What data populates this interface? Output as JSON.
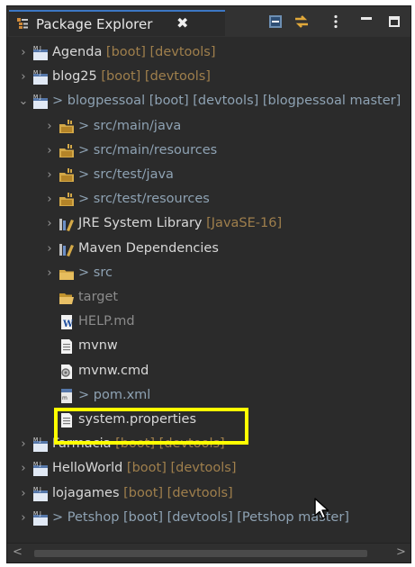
{
  "view": {
    "title": "Package Explorer",
    "close_glyph": "✖",
    "toolbar": [
      {
        "name": "collapse-all-icon"
      },
      {
        "name": "link-with-editor-icon"
      },
      {
        "name": "view-menu-icon"
      },
      {
        "name": "minimize-icon"
      },
      {
        "name": "maximize-icon"
      }
    ]
  },
  "tree": [
    {
      "text": "Agenda",
      "decoration": " [boot] [devtools]",
      "prefix": "",
      "suffix": "",
      "icon": "maven-project",
      "chevron": "collapsed",
      "level": 0,
      "git": false,
      "dim": false
    },
    {
      "text": "blog25",
      "decoration": " [boot] [devtools]",
      "prefix": "",
      "suffix": "",
      "icon": "maven-project",
      "chevron": "collapsed",
      "level": 0,
      "git": false,
      "dim": false
    },
    {
      "text": "blogpessoal [boot] [devtools] [blogpessoal master]",
      "decoration": "",
      "prefix": "> ",
      "suffix": "",
      "icon": "maven-project",
      "chevron": "expanded",
      "level": 0,
      "git": true,
      "dim": false
    },
    {
      "text": "src/main/java",
      "decoration": "",
      "prefix": "> ",
      "suffix": "",
      "icon": "source-folder",
      "chevron": "collapsed",
      "level": 1,
      "git": true,
      "dim": false
    },
    {
      "text": "src/main/resources",
      "decoration": "",
      "prefix": "> ",
      "suffix": "",
      "icon": "source-folder",
      "chevron": "collapsed",
      "level": 1,
      "git": true,
      "dim": false
    },
    {
      "text": "src/test/java",
      "decoration": "",
      "prefix": "> ",
      "suffix": "",
      "icon": "source-folder",
      "chevron": "collapsed",
      "level": 1,
      "git": true,
      "dim": false
    },
    {
      "text": "src/test/resources",
      "decoration": "",
      "prefix": "> ",
      "suffix": "",
      "icon": "source-folder",
      "chevron": "collapsed",
      "level": 1,
      "git": true,
      "dim": false
    },
    {
      "text": "JRE System Library",
      "decoration": " [JavaSE-16]",
      "prefix": "",
      "suffix": "",
      "icon": "library",
      "chevron": "collapsed",
      "level": 1,
      "git": false,
      "dim": false
    },
    {
      "text": "Maven Dependencies",
      "decoration": "",
      "prefix": "",
      "suffix": "",
      "icon": "library",
      "chevron": "collapsed",
      "level": 1,
      "git": false,
      "dim": false
    },
    {
      "text": "src",
      "decoration": "",
      "prefix": "> ",
      "suffix": "",
      "icon": "folder",
      "chevron": "collapsed",
      "level": 1,
      "git": true,
      "dim": false
    },
    {
      "text": "target",
      "decoration": "",
      "prefix": "",
      "suffix": "",
      "icon": "folder-open",
      "chevron": "none",
      "level": 1,
      "git": false,
      "dim": true
    },
    {
      "text": "HELP.md",
      "decoration": "",
      "prefix": "",
      "suffix": "",
      "icon": "md-file",
      "chevron": "none",
      "level": 1,
      "git": false,
      "dim": true
    },
    {
      "text": "mvnw",
      "decoration": "",
      "prefix": "",
      "suffix": "",
      "icon": "text-file",
      "chevron": "none",
      "level": 1,
      "git": false,
      "dim": false
    },
    {
      "text": "mvnw.cmd",
      "decoration": "",
      "prefix": "",
      "suffix": "",
      "icon": "cmd-file",
      "chevron": "none",
      "level": 1,
      "git": false,
      "dim": false
    },
    {
      "text": "pom.xml",
      "decoration": "",
      "prefix": "> ",
      "suffix": "",
      "icon": "xml-file",
      "chevron": "none",
      "level": 1,
      "git": true,
      "dim": false
    },
    {
      "text": "system.properties",
      "decoration": "",
      "prefix": "",
      "suffix": "",
      "icon": "properties-file",
      "chevron": "none",
      "level": 1,
      "git": false,
      "dim": false
    },
    {
      "text": "Farmacia",
      "decoration": " [boot] [devtools]",
      "prefix": "",
      "suffix": "",
      "icon": "maven-project",
      "chevron": "collapsed",
      "level": 0,
      "git": false,
      "dim": false
    },
    {
      "text": "HelloWorld",
      "decoration": " [boot] [devtools]",
      "prefix": "",
      "suffix": "",
      "icon": "maven-project",
      "chevron": "collapsed",
      "level": 0,
      "git": false,
      "dim": false
    },
    {
      "text": "lojagames",
      "decoration": " [boot] [devtools]",
      "prefix": "",
      "suffix": "",
      "icon": "maven-project",
      "chevron": "collapsed",
      "level": 0,
      "git": false,
      "dim": false
    },
    {
      "text": "Petshop [boot] [devtools] [Petshop master]",
      "decoration": "",
      "prefix": "> ",
      "suffix": "",
      "icon": "maven-project",
      "chevron": "collapsed",
      "level": 0,
      "git": true,
      "dim": false
    }
  ],
  "highlighted_item": "system.properties",
  "colors": {
    "background": "#2b2b2b",
    "text": "#d8d8d8",
    "decoration": "#9f7f4c",
    "git_text": "#8ea2b3",
    "highlight": "#ffff00",
    "tab_accent": "#3c77c4"
  }
}
